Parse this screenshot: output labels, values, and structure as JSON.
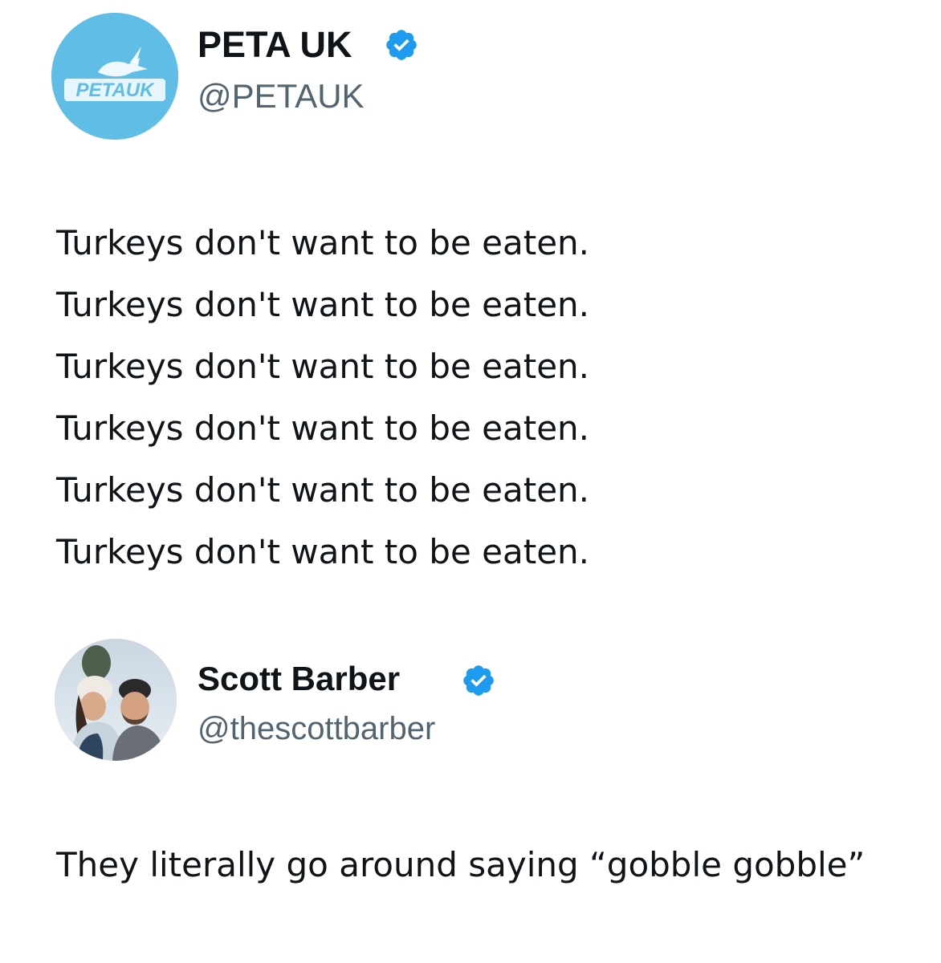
{
  "tweets": [
    {
      "author": {
        "display_name": "PETA UK",
        "handle": "@PETAUK",
        "verified": true,
        "avatar_text": "PETAUK",
        "avatar_color": "#5fbde6"
      },
      "lines": [
        "Turkeys don't want to be eaten.",
        "Turkeys don't want to be eaten.",
        "Turkeys don't want to be eaten.",
        "Turkeys don't want to be eaten.",
        "Turkeys don't want to be eaten.",
        "Turkeys don't want to be eaten."
      ]
    },
    {
      "author": {
        "display_name": "Scott Barber",
        "handle": "@thescottbarber",
        "verified": true
      },
      "text": "They literally go around saying “gobble gobble”"
    }
  ],
  "colors": {
    "verified_badge": "#1d9bf0",
    "handle_text": "#536471",
    "body_text": "#0f1419"
  },
  "icons": {
    "verified": "verified-badge-icon"
  }
}
